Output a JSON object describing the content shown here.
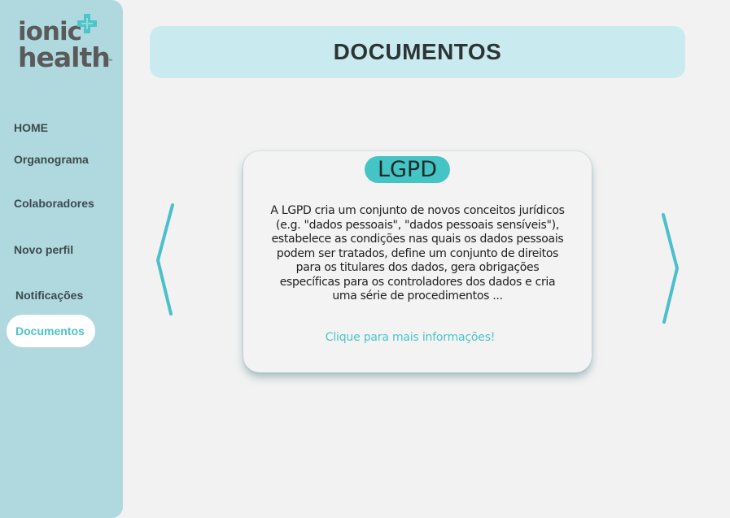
{
  "brand": {
    "line1": "ionic",
    "line2": "health",
    "trademark": "™",
    "icon": "cross-plus-icon"
  },
  "sidebar": {
    "items": [
      {
        "label": "HOME",
        "active": false
      },
      {
        "label": "Organograma",
        "active": false
      },
      {
        "label": "Colaboradores",
        "active": false
      },
      {
        "label": "Novo perfil",
        "active": false
      },
      {
        "label": "Notificações",
        "active": false
      },
      {
        "label": "Documentos",
        "active": true
      }
    ]
  },
  "header": {
    "title": "DOCUMENTOS"
  },
  "card": {
    "badge": "LGPD",
    "lines": [
      "A LGPD cria um conjunto de novos conceitos jurídicos",
      "(e.g. \"dados pessoais\", \"dados pessoais sensíveis\"),",
      "estabelece as condições nas quais os dados pessoais",
      "podem ser tratados, define um conjunto de direitos",
      "para os titulares dos dados, gera obrigações",
      "específicas para os controladores dos dados e cria",
      "uma série de procedimentos ..."
    ],
    "link": "Clique para mais informações!"
  },
  "carousel": {
    "prev_icon": "chevron-left-icon",
    "next_icon": "chevron-right-icon"
  },
  "colors": {
    "sidebar_bg": "#afd9df",
    "header_bg": "#c9ebef",
    "accent": "#4cc4c8",
    "badge_bg": "#44c4c4",
    "page_bg": "#f2f2f2"
  }
}
